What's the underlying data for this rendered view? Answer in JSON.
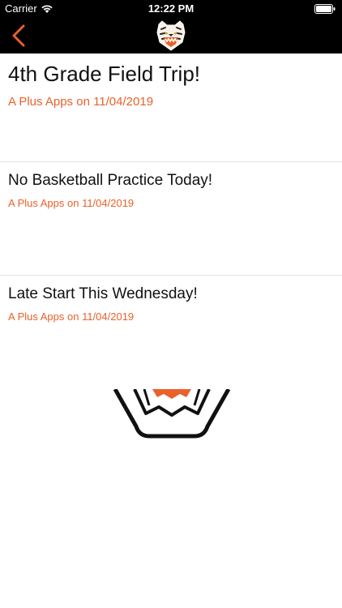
{
  "status_bar": {
    "carrier": "Carrier",
    "time": "12:22 PM"
  },
  "nav": {
    "back_icon": "chevron-left-icon",
    "logo": "tiger-logo",
    "accent_color": "#e8612a"
  },
  "posts": [
    {
      "title": "4th Grade Field Trip!",
      "meta": "A Plus Apps on 11/04/2019"
    },
    {
      "title": "No Basketball Practice Today!",
      "meta": "A Plus Apps on 11/04/2019"
    },
    {
      "title": "Late Start This Wednesday!",
      "meta": "A Plus Apps on 11/04/2019"
    }
  ]
}
